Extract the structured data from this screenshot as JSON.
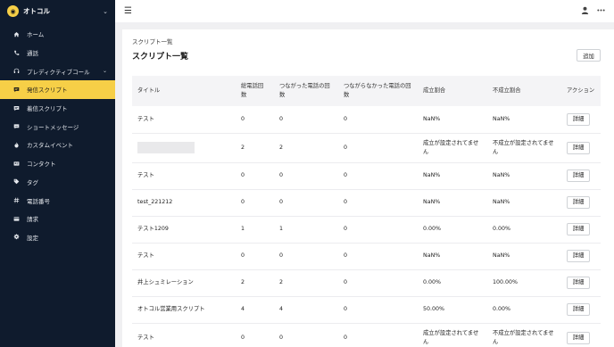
{
  "app": {
    "brand_name": "オトコル",
    "brand_initial": "●"
  },
  "sidebar": {
    "items": [
      {
        "label": "ホーム",
        "icon": "home-icon"
      },
      {
        "label": "通話",
        "icon": "phone-icon"
      },
      {
        "label": "プレディクティブコール",
        "icon": "headset-icon",
        "has_chevron": true
      },
      {
        "label": "発信スクリプト",
        "icon": "outgoing-script-icon",
        "active": true
      },
      {
        "label": "着信スクリプト",
        "icon": "incoming-script-icon"
      },
      {
        "label": "ショートメッセージ",
        "icon": "message-icon"
      },
      {
        "label": "カスタムイベント",
        "icon": "flame-icon"
      },
      {
        "label": "コンタクト",
        "icon": "contact-card-icon"
      },
      {
        "label": "タグ",
        "icon": "tag-icon"
      },
      {
        "label": "電話番号",
        "icon": "hash-icon"
      },
      {
        "label": "請求",
        "icon": "credit-card-icon"
      },
      {
        "label": "設定",
        "icon": "gear-icon"
      }
    ]
  },
  "header": {
    "breadcrumb": "スクリプト一覧",
    "title": "スクリプト一覧",
    "add_label": "追加"
  },
  "table": {
    "columns": [
      "タイトル",
      "総電話回数",
      "つながった電話の回数",
      "つながらなかった電話の回数",
      "成立割合",
      "不成立割合",
      "アクション"
    ],
    "rows": [
      {
        "title": "テスト",
        "total": "0",
        "connected": "0",
        "unconnected": "0",
        "success": "NaN%",
        "failure": "NaN%",
        "action": "詳細"
      },
      {
        "title": "",
        "title_blank": true,
        "total": "2",
        "connected": "2",
        "unconnected": "0",
        "success": "成立が設定されてません",
        "failure": "不成立が設定されてません",
        "action": "詳細"
      },
      {
        "title": "テスト",
        "total": "0",
        "connected": "0",
        "unconnected": "0",
        "success": "NaN%",
        "failure": "NaN%",
        "action": "詳細"
      },
      {
        "title": "test_221212",
        "total": "0",
        "connected": "0",
        "unconnected": "0",
        "success": "NaN%",
        "failure": "NaN%",
        "action": "詳細"
      },
      {
        "title": "テスト1209",
        "total": "1",
        "connected": "1",
        "unconnected": "0",
        "success": "0.00%",
        "failure": "0.00%",
        "action": "詳細"
      },
      {
        "title": "テスト",
        "total": "0",
        "connected": "0",
        "unconnected": "0",
        "success": "NaN%",
        "failure": "NaN%",
        "action": "詳細"
      },
      {
        "title": "井上シュミレーション",
        "total": "2",
        "connected": "2",
        "unconnected": "0",
        "success": "0.00%",
        "failure": "100.00%",
        "action": "詳細"
      },
      {
        "title": "オトコル営業用スクリプト",
        "total": "4",
        "connected": "4",
        "unconnected": "0",
        "success": "50.00%",
        "failure": "0.00%",
        "action": "詳細"
      },
      {
        "title": "テスト",
        "total": "0",
        "connected": "0",
        "unconnected": "0",
        "success": "成立が設定されてません",
        "failure": "不成立が設定されてません",
        "action": "詳細"
      }
    ]
  }
}
